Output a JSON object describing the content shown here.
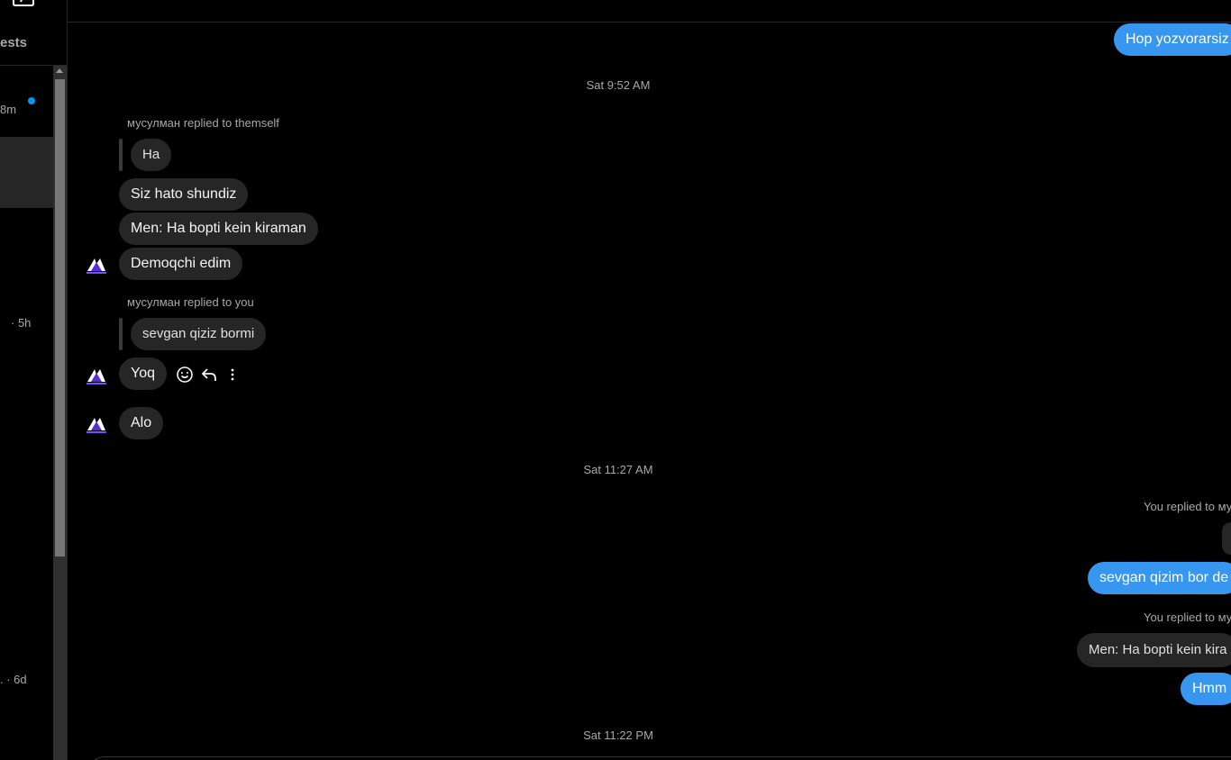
{
  "sidebar": {
    "compose_icon": "compose-icon",
    "requests_label": "ests",
    "threads": [
      {
        "time": "8m",
        "unread": true
      },
      {
        "time": "",
        "active": true
      },
      {
        "time": "· 5h"
      },
      {
        "time": ". · 6d"
      }
    ]
  },
  "chat": {
    "top_outgoing": "Hop yozvorarsiz",
    "timestamps": [
      "Sat 9:52 AM",
      "Sat 11:27 AM",
      "Sat 11:22 PM"
    ],
    "group1": {
      "reply_note": "мусулман replied to themself",
      "quoted": "Ha",
      "messages": [
        "Siz hato shundiz",
        "Men: Ha bopti kein kiraman",
        "Demoqchi edim"
      ]
    },
    "group2": {
      "reply_note": "мусулман replied to you",
      "quoted": "sevgan qiziz bormi",
      "message": "Yoq",
      "actions": [
        "react-icon",
        "reply-icon",
        "more-icon"
      ]
    },
    "group3": {
      "message": "Alo"
    },
    "outgoing": {
      "reply_note_1": "You replied to му",
      "message_1": "sevgan qizim bor de",
      "reply_note_2": "You replied to му",
      "quoted_2": "Men: Ha bopti kein kira",
      "message_2": "Hmm"
    },
    "colors": {
      "outgoing": "#3797f0",
      "incoming": "#262626",
      "background": "#000000"
    }
  }
}
